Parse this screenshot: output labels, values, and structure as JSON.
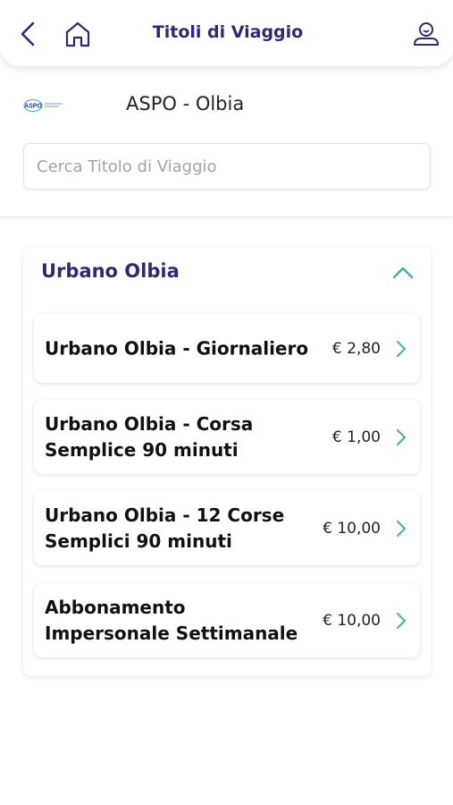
{
  "header": {
    "title": "Titoli di Viaggio",
    "back_icon": "chevron-left-icon",
    "home_icon": "home-icon",
    "profile_icon": "user-icon"
  },
  "agency": {
    "name": "ASPO - Olbia",
    "logo_text": "ASPO"
  },
  "search": {
    "placeholder": "Cerca Titolo di Viaggio",
    "value": ""
  },
  "section": {
    "title": "Urbano Olbia",
    "expanded": true,
    "tickets": [
      {
        "name": "Urbano Olbia - Giornaliero",
        "price": "€ 2,80"
      },
      {
        "name": "Urbano Olbia - Corsa Semplice 90 minuti",
        "price": "€ 1,00"
      },
      {
        "name": "Urbano Olbia - 12 Corse Semplici 90 minuti",
        "price": "€ 10,00"
      },
      {
        "name": "Abbonamento Impersonale Settimanale",
        "price": "€ 10,00"
      }
    ]
  },
  "colors": {
    "title": "#2c2a73",
    "accent": "#3fb59a"
  }
}
